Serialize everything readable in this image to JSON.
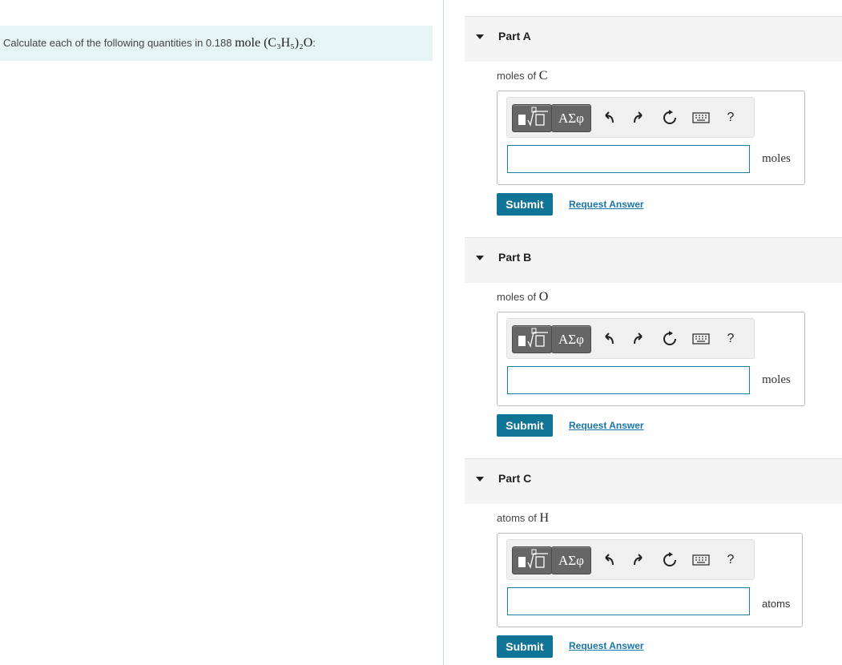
{
  "question": {
    "prefix": "Calculate each of the following quantities in 0.188 ",
    "math": "mole (C₃H₅)₂O",
    "suffix": ":"
  },
  "toolbar": {
    "greek_label": "ΑΣφ",
    "help_label": "?",
    "icons": [
      "templates-icon",
      "undo-icon",
      "redo-icon",
      "reset-icon",
      "keyboard-icon",
      "help-icon"
    ]
  },
  "parts": [
    {
      "title": "Part A",
      "prompt_text": "moles of ",
      "prompt_math": "C",
      "value": "",
      "unit": "moles",
      "submit_label": "Submit",
      "request_label": "Request Answer"
    },
    {
      "title": "Part B",
      "prompt_text": "moles of ",
      "prompt_math": "O",
      "value": "",
      "unit": "moles",
      "submit_label": "Submit",
      "request_label": "Request Answer"
    },
    {
      "title": "Part C",
      "prompt_text": "atoms of ",
      "prompt_math": "H",
      "value": "",
      "unit": "atoms",
      "submit_label": "Submit",
      "request_label": "Request Answer"
    }
  ],
  "colors": {
    "accent": "#0f7495",
    "banner": "#e6f4f5",
    "link": "#1a75a8",
    "input_border": "#1a7ea3"
  }
}
